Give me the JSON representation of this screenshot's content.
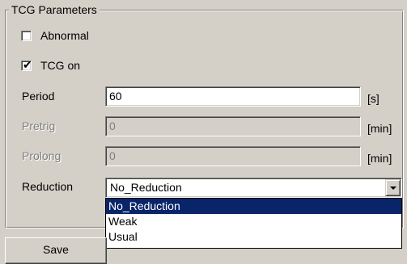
{
  "group": {
    "title": "TCG Parameters"
  },
  "checkboxes": [
    {
      "label": "Abnormal",
      "checked": false
    },
    {
      "label": "TCG on",
      "checked": true,
      "mark": "✔"
    }
  ],
  "fields": {
    "period": {
      "label": "Period",
      "value": "60",
      "unit": "[s]",
      "enabled": true
    },
    "pretrig": {
      "label": "Pretrig",
      "value": "0",
      "unit": "[min]",
      "enabled": false
    },
    "prolong": {
      "label": "Prolong",
      "value": "0",
      "unit": "[min]",
      "enabled": false
    }
  },
  "reduction": {
    "label": "Reduction",
    "selected": "No_Reduction",
    "options": [
      "No_Reduction",
      "Weak",
      "Usual"
    ],
    "highlighted_index": 0
  },
  "buttons": {
    "save": "Save"
  },
  "colors": {
    "face": "#d4d0c8",
    "highlight": "#0a246a",
    "disabled_text": "#808080"
  }
}
